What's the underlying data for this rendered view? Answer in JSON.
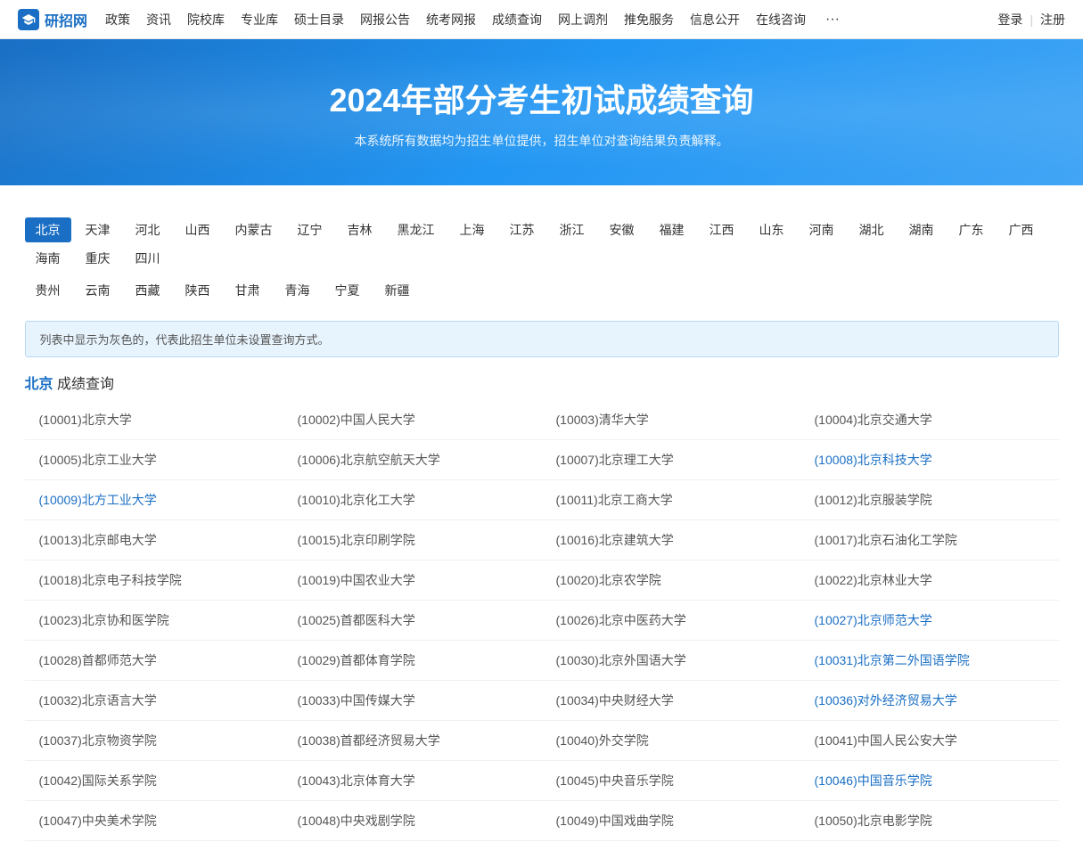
{
  "nav": {
    "logo_text": "研招网",
    "links": [
      "政策",
      "资讯",
      "院校库",
      "专业库",
      "硕士目录",
      "网报公告",
      "统考网报",
      "成绩查询",
      "网上调剂",
      "推免服务",
      "信息公开",
      "在线咨询"
    ],
    "auth": [
      "登录",
      "注册"
    ]
  },
  "hero": {
    "title": "2024年部分考生初试成绩查询",
    "subtitle": "本系统所有数据均为招生单位提供，招生单位对查询结果负责解释。"
  },
  "regions": {
    "first_row": [
      "北京",
      "天津",
      "河北",
      "山西",
      "内蒙古",
      "辽宁",
      "吉林",
      "黑龙江",
      "上海",
      "江苏",
      "浙江",
      "安徽",
      "福建",
      "江西",
      "山东",
      "河南",
      "湖北",
      "湖南",
      "广东",
      "广西",
      "海南",
      "重庆",
      "四川"
    ],
    "second_row": [
      "贵州",
      "云南",
      "西藏",
      "陕西",
      "甘肃",
      "青海",
      "宁夏",
      "新疆"
    ],
    "active": "北京"
  },
  "info_text": "列表中显示为灰色的，代表此招生单位未设置查询方式。",
  "section": {
    "region": "北京",
    "label": "成绩查询"
  },
  "universities": [
    [
      {
        "code": "10001",
        "name": "北京大学",
        "link": false
      },
      {
        "code": "10002",
        "name": "中国人民大学",
        "link": false
      },
      {
        "code": "10003",
        "name": "清华大学",
        "link": false
      },
      {
        "code": "10004",
        "name": "北京交通大学",
        "link": false
      }
    ],
    [
      {
        "code": "10005",
        "name": "北京工业大学",
        "link": false
      },
      {
        "code": "10006",
        "name": "北京航空航天大学",
        "link": false
      },
      {
        "code": "10007",
        "name": "北京理工大学",
        "link": false
      },
      {
        "code": "10008",
        "name": "北京科技大学",
        "link": true
      }
    ],
    [
      {
        "code": "10009",
        "name": "北方工业大学",
        "link": true
      },
      {
        "code": "10010",
        "name": "北京化工大学",
        "link": false
      },
      {
        "code": "10011",
        "name": "北京工商大学",
        "link": false
      },
      {
        "code": "10012",
        "name": "北京服装学院",
        "link": false
      }
    ],
    [
      {
        "code": "10013",
        "name": "北京邮电大学",
        "link": false
      },
      {
        "code": "10015",
        "name": "北京印刷学院",
        "link": false
      },
      {
        "code": "10016",
        "name": "北京建筑大学",
        "link": false
      },
      {
        "code": "10017",
        "name": "北京石油化工学院",
        "link": false
      }
    ],
    [
      {
        "code": "10018",
        "name": "北京电子科技学院",
        "link": false
      },
      {
        "code": "10019",
        "name": "中国农业大学",
        "link": false
      },
      {
        "code": "10020",
        "name": "北京农学院",
        "link": false
      },
      {
        "code": "10022",
        "name": "北京林业大学",
        "link": false
      }
    ],
    [
      {
        "code": "10023",
        "name": "北京协和医学院",
        "link": false
      },
      {
        "code": "10025",
        "name": "首都医科大学",
        "link": false
      },
      {
        "code": "10026",
        "name": "北京中医药大学",
        "link": false
      },
      {
        "code": "10027",
        "name": "北京师范大学",
        "link": true
      }
    ],
    [
      {
        "code": "10028",
        "name": "首都师范大学",
        "link": false
      },
      {
        "code": "10029",
        "name": "首都体育学院",
        "link": false
      },
      {
        "code": "10030",
        "name": "北京外国语大学",
        "link": false
      },
      {
        "code": "10031",
        "name": "北京第二外国语学院",
        "link": true
      }
    ],
    [
      {
        "code": "10032",
        "name": "北京语言大学",
        "link": false
      },
      {
        "code": "10033",
        "name": "中国传媒大学",
        "link": false
      },
      {
        "code": "10034",
        "name": "中央财经大学",
        "link": false
      },
      {
        "code": "10036",
        "name": "对外经济贸易大学",
        "link": true
      }
    ],
    [
      {
        "code": "10037",
        "name": "北京物资学院",
        "link": false
      },
      {
        "code": "10038",
        "name": "首都经济贸易大学",
        "link": false
      },
      {
        "code": "10040",
        "name": "外交学院",
        "link": false
      },
      {
        "code": "10041",
        "name": "中国人民公安大学",
        "link": false
      }
    ],
    [
      {
        "code": "10042",
        "name": "国际关系学院",
        "link": false
      },
      {
        "code": "10043",
        "name": "北京体育大学",
        "link": false
      },
      {
        "code": "10045",
        "name": "中央音乐学院",
        "link": false
      },
      {
        "code": "10046",
        "name": "中国音乐学院",
        "link": true
      }
    ],
    [
      {
        "code": "10047",
        "name": "中央美术学院",
        "link": false
      },
      {
        "code": "10048",
        "name": "中央戏剧学院",
        "link": false
      },
      {
        "code": "10049",
        "name": "中国戏曲学院",
        "link": false
      },
      {
        "code": "10050",
        "name": "北京电影学院",
        "link": false
      }
    ]
  ]
}
